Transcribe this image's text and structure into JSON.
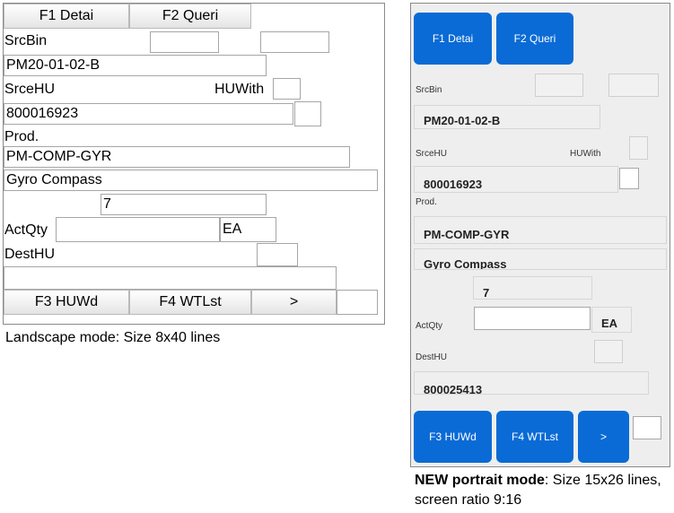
{
  "landscape": {
    "buttons_top": [
      "F1 Detai",
      "F2 Queri"
    ],
    "labels": {
      "src_bin": "SrcBin",
      "src_hu": "SrceHU",
      "hu_with": "HUWith",
      "prod": "Prod.",
      "act_qty": "ActQty",
      "dest_hu": "DestHU"
    },
    "values": {
      "src_bin": "PM20-01-02-B",
      "src_hu": "800016923",
      "product": "PM-COMP-GYR",
      "description": "Gyro Compass",
      "quantity": "7",
      "unit": "EA",
      "dest_hu": ""
    },
    "buttons_bottom": [
      "F3 HUWd",
      "F4 WTLst",
      ">"
    ]
  },
  "landscape_caption": "Landscape mode: Size 8x40 lines",
  "portrait": {
    "buttons_top": [
      "F1 Detai",
      "F2 Queri"
    ],
    "labels": {
      "src_bin": "SrcBin",
      "src_hu": "SrceHU",
      "hu_with": "HUWith",
      "prod": "Prod.",
      "act_qty": "ActQty",
      "dest_hu": "DestHU"
    },
    "values": {
      "src_bin": "PM20-01-02-B",
      "src_hu": "800016923",
      "product": "PM-COMP-GYR",
      "description": "Gyro Compass",
      "quantity": "7",
      "unit": "EA",
      "dest_hu": "800025413"
    },
    "buttons_bottom": [
      "F3 HUWd",
      "F4 WTLst",
      ">"
    ]
  },
  "portrait_caption": {
    "bold": "NEW portrait mode",
    "rest": ": Size 15x26 lines, screen ratio 9:16"
  },
  "colors": {
    "portrait_button": "#0a6bd6",
    "portrait_background": "#eeeeee"
  }
}
